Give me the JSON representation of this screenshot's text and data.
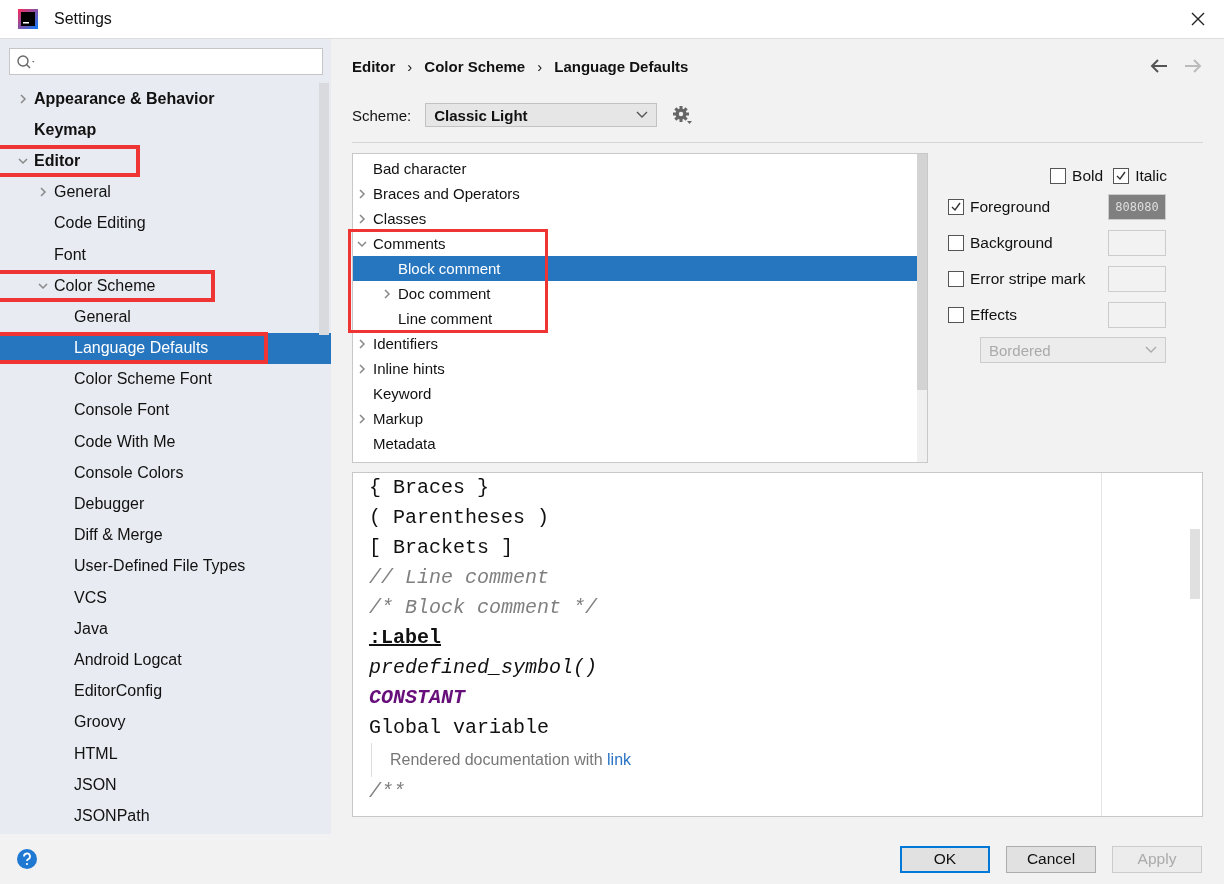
{
  "window": {
    "title": "Settings"
  },
  "sidebar": {
    "items": [
      {
        "label": "Appearance & Behavior",
        "expanded": false,
        "selected": false,
        "highlighted": false
      },
      {
        "label": "Keymap",
        "selected": false,
        "highlighted": false
      },
      {
        "label": "Editor",
        "expanded": true,
        "selected": false,
        "highlighted": true,
        "children": [
          {
            "label": "General",
            "expanded": false,
            "selected": false,
            "highlighted": false
          },
          {
            "label": "Code Editing",
            "selected": false,
            "highlighted": false
          },
          {
            "label": "Font",
            "selected": false,
            "highlighted": false
          },
          {
            "label": "Color Scheme",
            "expanded": true,
            "selected": false,
            "highlighted": true,
            "children": [
              {
                "label": "General",
                "selected": false,
                "highlighted": false
              },
              {
                "label": "Language Defaults",
                "selected": true,
                "highlighted": true
              },
              {
                "label": "Color Scheme Font",
                "selected": false,
                "highlighted": false
              },
              {
                "label": "Console Font",
                "selected": false,
                "highlighted": false
              },
              {
                "label": "Code With Me",
                "selected": false,
                "highlighted": false
              },
              {
                "label": "Console Colors",
                "selected": false,
                "highlighted": false
              },
              {
                "label": "Debugger",
                "selected": false,
                "highlighted": false
              },
              {
                "label": "Diff & Merge",
                "selected": false,
                "highlighted": false
              },
              {
                "label": "User-Defined File Types",
                "selected": false,
                "highlighted": false
              },
              {
                "label": "VCS",
                "selected": false,
                "highlighted": false
              },
              {
                "label": "Java",
                "selected": false,
                "highlighted": false
              },
              {
                "label": "Android Logcat",
                "selected": false,
                "highlighted": false
              },
              {
                "label": "EditorConfig",
                "selected": false,
                "highlighted": false
              },
              {
                "label": "Groovy",
                "selected": false,
                "highlighted": false
              },
              {
                "label": "HTML",
                "selected": false,
                "highlighted": false
              },
              {
                "label": "JSON",
                "selected": false,
                "highlighted": false
              },
              {
                "label": "JSONPath",
                "selected": false,
                "highlighted": false
              }
            ]
          }
        ]
      }
    ]
  },
  "breadcrumbs": {
    "items": [
      "Editor",
      "Color Scheme",
      "Language Defaults"
    ],
    "separator": "›"
  },
  "nav": [
    {
      "kind": "back",
      "disabled": false
    },
    {
      "kind": "forward",
      "disabled": true
    }
  ],
  "scheme": {
    "label": "Scheme:",
    "value": "Classic Light"
  },
  "attributes": {
    "items": [
      {
        "label": "Bad character",
        "selected": false,
        "highlighted": false
      },
      {
        "label": "Braces and Operators",
        "expanded": false,
        "selected": false,
        "highlighted": false
      },
      {
        "label": "Classes",
        "expanded": false,
        "selected": false,
        "highlighted": false
      },
      {
        "label": "Comments",
        "expanded": true,
        "selected": false,
        "highlighted": true,
        "children": [
          {
            "label": "Block comment",
            "selected": true
          },
          {
            "label": "Doc comment",
            "expanded": false,
            "selected": false
          },
          {
            "label": "Line comment",
            "selected": false
          }
        ]
      },
      {
        "label": "Identifiers",
        "expanded": false,
        "selected": false,
        "highlighted": false
      },
      {
        "label": "Inline hints",
        "expanded": false,
        "selected": false,
        "highlighted": false
      },
      {
        "label": "Keyword",
        "selected": false,
        "highlighted": false
      },
      {
        "label": "Markup",
        "expanded": false,
        "selected": false,
        "highlighted": false
      },
      {
        "label": "Metadata",
        "selected": false,
        "highlighted": false
      }
    ]
  },
  "font_style": [
    {
      "label": "Bold",
      "checked": false
    },
    {
      "label": "Italic",
      "checked": true
    }
  ],
  "options": [
    {
      "label": "Foreground",
      "checked": true,
      "value": "808080"
    },
    {
      "label": "Background",
      "checked": false
    },
    {
      "label": "Error stripe mark",
      "checked": false
    },
    {
      "label": "Effects",
      "checked": false
    }
  ],
  "effect_type": {
    "value": "Bordered",
    "disabled": true
  },
  "preview": {
    "lines": [
      {
        "kind": "plain",
        "text": "{ Braces }"
      },
      {
        "kind": "plain",
        "text": "( Parentheses )"
      },
      {
        "kind": "plain",
        "text": "[ Brackets ]"
      },
      {
        "kind": "comment",
        "text": "// Line comment"
      },
      {
        "kind": "comment",
        "text": "/* Block comment */"
      },
      {
        "kind": "label",
        "text": ":Label"
      },
      {
        "kind": "predefined",
        "text": "predefined_symbol()"
      },
      {
        "kind": "constant",
        "text": "CONSTANT"
      },
      {
        "kind": "plain",
        "text": "Global variable"
      },
      {
        "kind": "doc",
        "text": "Rendered documentation with",
        "link": "link"
      },
      {
        "kind": "comment",
        "text": "/**"
      }
    ]
  },
  "buttons": [
    {
      "label": "OK",
      "kind": "default",
      "disabled": false
    },
    {
      "label": "Cancel",
      "kind": "normal",
      "disabled": false
    },
    {
      "label": "Apply",
      "kind": "normal",
      "disabled": true
    }
  ]
}
